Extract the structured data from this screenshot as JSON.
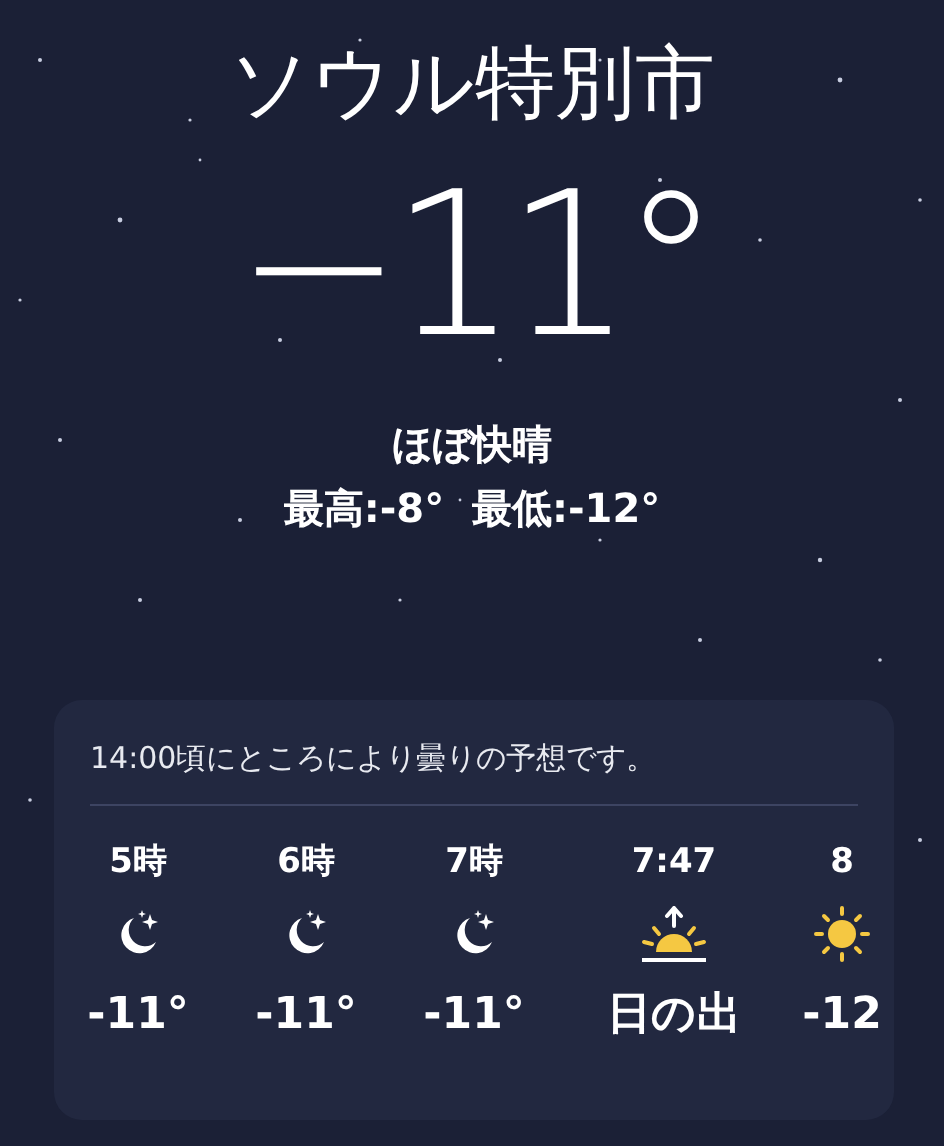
{
  "location": {
    "city": "ソウル特別市",
    "temperature": "−11°",
    "condition": "ほぼ快晴",
    "high_low": "最高:-8°  最低:-12°"
  },
  "hourly_forecast": {
    "summary": "14:00頃にところにより曇りの予想です。",
    "hours": [
      {
        "time": "5時",
        "kind": "moon",
        "temp": "-11°"
      },
      {
        "time": "6時",
        "kind": "moon",
        "temp": "-11°"
      },
      {
        "time": "7時",
        "kind": "moon",
        "temp": "-11°"
      },
      {
        "time": "7:47",
        "kind": "sunrise",
        "temp": "日の出"
      },
      {
        "time": "8",
        "kind": "sun",
        "temp": "-12"
      }
    ]
  }
}
